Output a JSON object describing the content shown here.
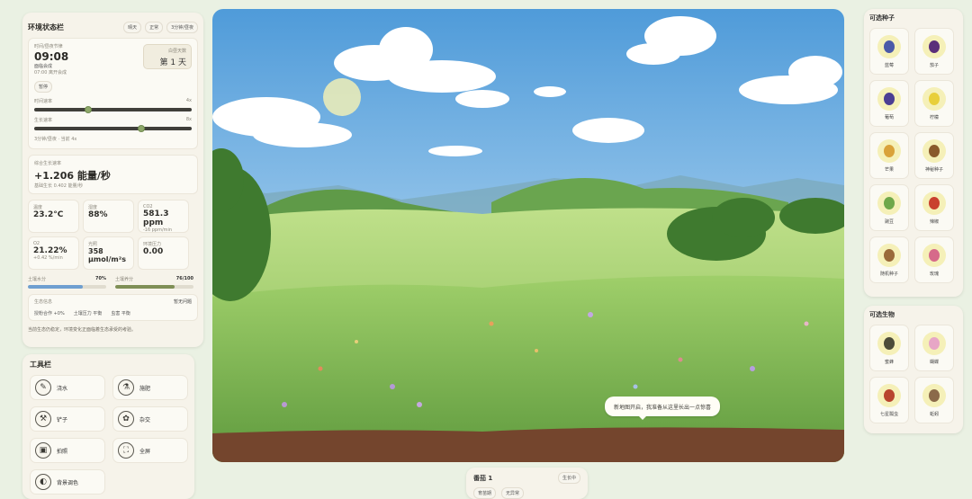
{
  "left": {
    "title": "环境状态栏",
    "buttons": [
      "晴天",
      "正常",
      "3分钟/昼夜"
    ],
    "time_card": {
      "label": "时间/昼夜节律",
      "time": "09:08",
      "phase": "面临会成",
      "phase_sub": "07:00 离开会成",
      "day_label": "白昼天数",
      "day_value": "第 1 天",
      "pause": "暂停",
      "slider1_label": "时间速率",
      "slider1_value": "4x",
      "slider1_level": 0.34,
      "slider2_label": "生长速率",
      "slider2_value": "8x",
      "slider2_level": 0.68,
      "footer": "3分钟/昼夜 · 当前 4x"
    },
    "growth": {
      "label": "综合生长速率",
      "value": "+1.206 能量/秒",
      "sub": "基础生长 0.402 能量/秒"
    },
    "metrics": [
      {
        "label": "温度",
        "value": "23.2°C",
        "sub": ""
      },
      {
        "label": "湿度",
        "value": "88%",
        "sub": ""
      },
      {
        "label": "CO2",
        "value": "581.3 ppm",
        "sub": "-16 ppm/min"
      },
      {
        "label": "O2",
        "value": "21.22%",
        "sub": "+0.42 %/min"
      },
      {
        "label": "光照",
        "value": "358 μmol/m²s",
        "sub": ""
      },
      {
        "label": "环境压力",
        "value": "0.00",
        "sub": ""
      }
    ],
    "soil_water": {
      "label": "土壤水分",
      "value": "70%",
      "level": 0.7,
      "color": "#6f9fd0"
    },
    "soil_nutrient": {
      "label": "土壤养分",
      "value": "76/100",
      "level": 0.76,
      "color": "#7f8f56"
    },
    "life": {
      "label": "生态信息",
      "status": "暂无问题",
      "tags": [
        "授粉合作 +0%",
        "土壤压力 平衡",
        "虫害 平衡"
      ]
    },
    "hint": "当前生态仍稳定，环境变化正面临着生态承受的考验。"
  },
  "tools": {
    "title": "工具栏",
    "items": [
      {
        "label": "浇水",
        "icon": "watering-can-icon",
        "glyph": "✎"
      },
      {
        "label": "施肥",
        "icon": "fertilizer-icon",
        "glyph": "⚗"
      },
      {
        "label": "铲子",
        "icon": "shovel-icon",
        "glyph": "⚒"
      },
      {
        "label": "杂交",
        "icon": "hybrid-icon",
        "glyph": "✿"
      },
      {
        "label": "拍照",
        "icon": "camera-icon",
        "glyph": "▣"
      },
      {
        "label": "全屏",
        "icon": "fullscreen-icon",
        "glyph": "⛶"
      },
      {
        "label": "背景调色",
        "icon": "palette-icon",
        "glyph": "◐"
      }
    ]
  },
  "scene": {
    "bubble": "新地图开启，我准备从这里长出一点惊喜"
  },
  "selected": {
    "name": "番茄 1",
    "action": "生长中",
    "tags": [
      "育苗期",
      "无异常"
    ]
  },
  "seeds": {
    "title": "可选种子",
    "items": [
      {
        "label": "蓝莓",
        "icon": "blueberry-icon",
        "color": "#4b5aa8"
      },
      {
        "label": "茄子",
        "icon": "eggplant-icon",
        "color": "#5b2f7a"
      },
      {
        "label": "葡萄",
        "icon": "grape-icon",
        "color": "#4b3e93"
      },
      {
        "label": "柠檬",
        "icon": "lemon-icon",
        "color": "#e8cf3b"
      },
      {
        "label": "芒果",
        "icon": "mango-icon",
        "color": "#d9a23a"
      },
      {
        "label": "神秘种子",
        "icon": "mystery-seed-icon",
        "color": "#8a5a2b"
      },
      {
        "label": "豌豆",
        "icon": "pea-icon",
        "color": "#6fa84a"
      },
      {
        "label": "辣椒",
        "icon": "chili-icon",
        "color": "#c9402e"
      },
      {
        "label": "随机种子",
        "icon": "random-seed-icon",
        "color": "#9a6a3a"
      },
      {
        "label": "玫瑰",
        "icon": "rose-icon",
        "color": "#d66a8a"
      }
    ]
  },
  "creatures": {
    "title": "可选生物",
    "items": [
      {
        "label": "蜜蜂",
        "icon": "bee-icon",
        "color": "#4c4c3a"
      },
      {
        "label": "蝴蝶",
        "icon": "butterfly-icon",
        "color": "#e7a6c6"
      },
      {
        "label": "七星瓢虫",
        "icon": "ladybug-icon",
        "color": "#b8452e"
      },
      {
        "label": "蚯蚓",
        "icon": "earthworm-icon",
        "color": "#8b6a4a"
      }
    ]
  }
}
